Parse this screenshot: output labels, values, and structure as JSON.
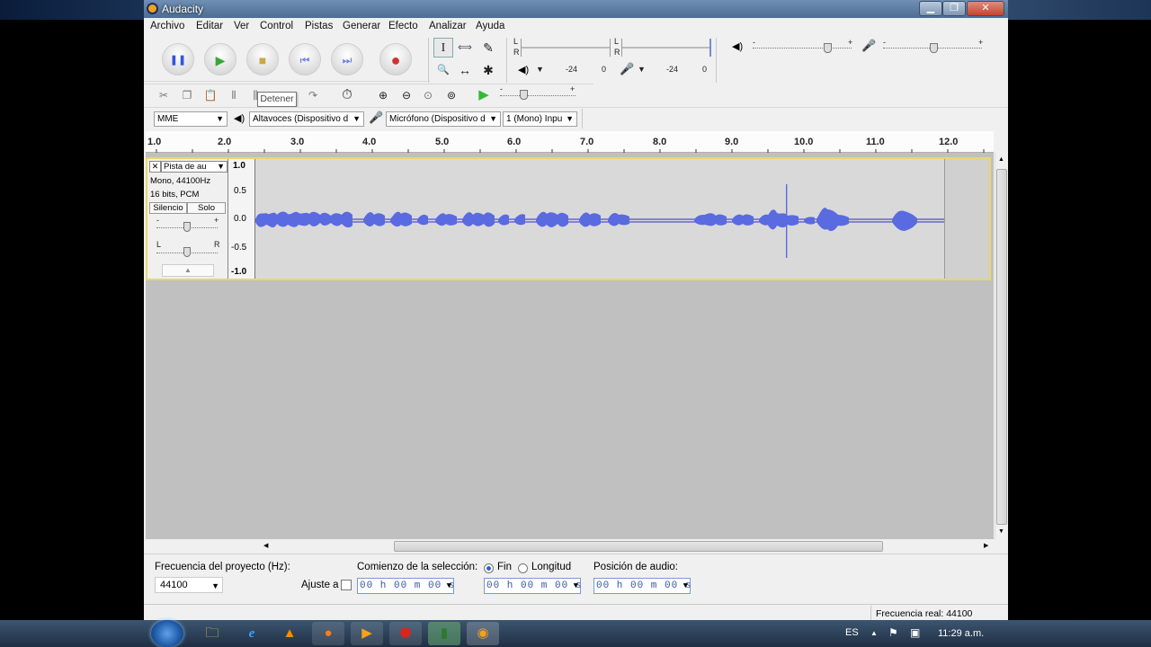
{
  "window": {
    "title": "Audacity",
    "min": "▁",
    "max": "❐",
    "close": "✕"
  },
  "menu": [
    "Archivo",
    "Editar",
    "Ver",
    "Control",
    "Pistas",
    "Generar",
    "Efecto",
    "Analizar",
    "Ayuda"
  ],
  "transport": {
    "pause": "❚❚",
    "play": "▶",
    "stop": "■",
    "skip_start": "⏮",
    "skip_end": "⏭",
    "record": "●"
  },
  "tools": {
    "selection": "I",
    "envelope": "⟺",
    "draw": "✎",
    "zoom": "🔍",
    "timeshift": "↔",
    "multi": "✱"
  },
  "meters": {
    "left": "L",
    "right": "R",
    "labels": [
      "-24",
      "0",
      "-24",
      "0"
    ]
  },
  "mixer": {
    "minus": "-",
    "plus": "+"
  },
  "tooltip": "Detener",
  "devices": {
    "host": "MME",
    "playback": "Altavoces (Dispositivo d",
    "recording": "Micrófono (Dispositivo d",
    "channels": "1 (Mono) Inpu"
  },
  "ruler": {
    "ticks": [
      "1.0",
      "2.0",
      "3.0",
      "4.0",
      "5.0",
      "6.0",
      "7.0",
      "8.0",
      "9.0",
      "10.0",
      "11.0",
      "12.0"
    ]
  },
  "track": {
    "name": "Pista de au",
    "close": "✕",
    "info1": "Mono, 44100Hz",
    "info2": "16 bits, PCM",
    "mute": "Silencio",
    "solo": "Solo",
    "gain_minus": "-",
    "gain_plus": "+",
    "pan_l": "L",
    "pan_r": "R",
    "scale": [
      "1.0",
      "0.5",
      "0.0",
      "-0.5",
      "-1.0"
    ]
  },
  "selection_bar": {
    "rate_label": "Frecuencia del proyecto (Hz):",
    "rate_value": "44100",
    "snap_label": "Ajuste a",
    "sel_start_label": "Comienzo de la selección:",
    "end_label": "Fin",
    "length_label": "Longitud",
    "audio_pos_label": "Posición de audio:",
    "time_start": "00 h 00 m 00 s",
    "time_end": "00 h 00 m 00 s",
    "time_pos": "00 h 00 m 00 s"
  },
  "status": {
    "actual_rate": "Frecuencia real: 44100"
  },
  "taskbar": {
    "lang": "ES",
    "clock": "11:29 a.m."
  }
}
